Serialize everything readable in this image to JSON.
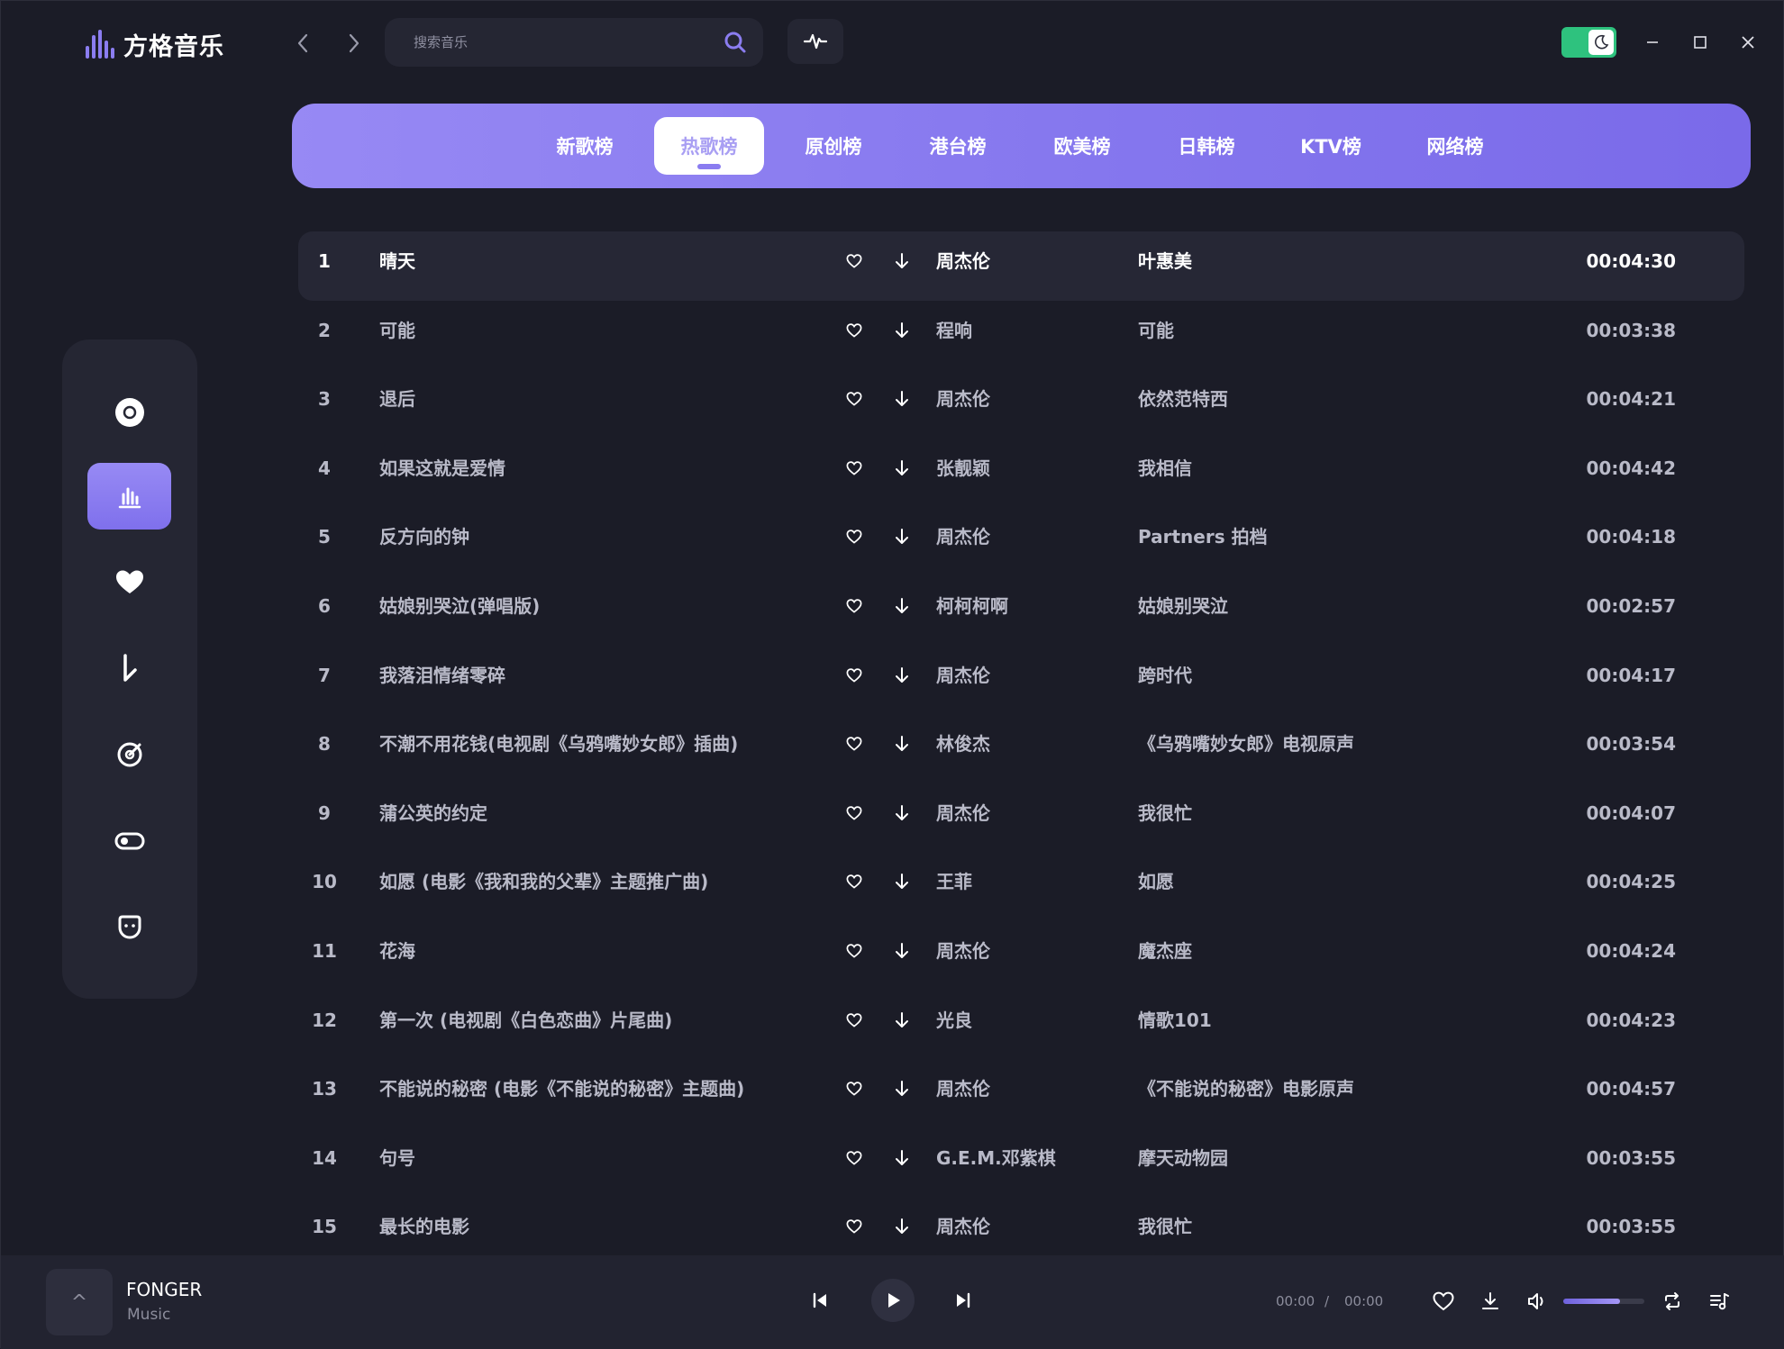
{
  "app": {
    "title": "方格音乐"
  },
  "search": {
    "placeholder": "搜索音乐"
  },
  "colors": {
    "accent": "#8b7df0",
    "theme_toggle": "#2ec27e",
    "background": "#1b1c27"
  },
  "tabs": [
    {
      "label": "新歌榜",
      "active": false
    },
    {
      "label": "热歌榜",
      "active": true
    },
    {
      "label": "原创榜",
      "active": false
    },
    {
      "label": "港台榜",
      "active": false
    },
    {
      "label": "欧美榜",
      "active": false
    },
    {
      "label": "日韩榜",
      "active": false
    },
    {
      "label": "KTV榜",
      "active": false
    },
    {
      "label": "网络榜",
      "active": false
    }
  ],
  "sidebar": {
    "items": [
      {
        "icon": "disc-icon",
        "active": false
      },
      {
        "icon": "chart-icon",
        "active": true
      },
      {
        "icon": "heart-icon",
        "active": false
      },
      {
        "icon": "download-icon",
        "active": false
      },
      {
        "icon": "radar-icon",
        "active": false
      },
      {
        "icon": "toggle-icon",
        "active": false
      },
      {
        "icon": "face-icon",
        "active": false
      }
    ]
  },
  "songs": [
    {
      "index": "1",
      "title": "晴天",
      "artist": "周杰伦",
      "album": "叶惠美",
      "duration": "00:04:30"
    },
    {
      "index": "2",
      "title": "可能",
      "artist": "程响",
      "album": "可能",
      "duration": "00:03:38"
    },
    {
      "index": "3",
      "title": "退后",
      "artist": "周杰伦",
      "album": "依然范特西",
      "duration": "00:04:21"
    },
    {
      "index": "4",
      "title": "如果这就是爱情",
      "artist": "张靓颖",
      "album": "我相信",
      "duration": "00:04:42"
    },
    {
      "index": "5",
      "title": "反方向的钟",
      "artist": "周杰伦",
      "album": "Partners 拍档",
      "duration": "00:04:18"
    },
    {
      "index": "6",
      "title": "姑娘别哭泣(弹唱版)",
      "artist": "柯柯柯啊",
      "album": "姑娘别哭泣",
      "duration": "00:02:57"
    },
    {
      "index": "7",
      "title": "我落泪情绪零碎",
      "artist": "周杰伦",
      "album": "跨时代",
      "duration": "00:04:17"
    },
    {
      "index": "8",
      "title": "不潮不用花钱(电视剧《乌鸦嘴妙女郎》插曲)",
      "artist": "林俊杰",
      "album": "《乌鸦嘴妙女郎》电视原声",
      "duration": "00:03:54"
    },
    {
      "index": "9",
      "title": "蒲公英的约定",
      "artist": "周杰伦",
      "album": "我很忙",
      "duration": "00:04:07"
    },
    {
      "index": "10",
      "title": "如愿 (电影《我和我的父辈》主题推广曲)",
      "artist": "王菲",
      "album": "如愿",
      "duration": "00:04:25"
    },
    {
      "index": "11",
      "title": "花海",
      "artist": "周杰伦",
      "album": "魔杰座",
      "duration": "00:04:24"
    },
    {
      "index": "12",
      "title": "第一次 (电视剧《白色恋曲》片尾曲)",
      "artist": "光良",
      "album": "情歌101",
      "duration": "00:04:23"
    },
    {
      "index": "13",
      "title": "不能说的秘密 (电影《不能说的秘密》主题曲)",
      "artist": "周杰伦",
      "album": "《不能说的秘密》电影原声",
      "duration": "00:04:57"
    },
    {
      "index": "14",
      "title": "句号",
      "artist": "G.E.M.邓紫棋",
      "album": "摩天动物园",
      "duration": "00:03:55"
    },
    {
      "index": "15",
      "title": "最长的电影",
      "artist": "周杰伦",
      "album": "我很忙",
      "duration": "00:03:55"
    }
  ],
  "player": {
    "cover_glyph": "^",
    "track_name": "FONGER",
    "track_sub": "Music",
    "current_time": "00:00",
    "separator": "/",
    "total_time": "00:00",
    "volume": 0.7
  }
}
